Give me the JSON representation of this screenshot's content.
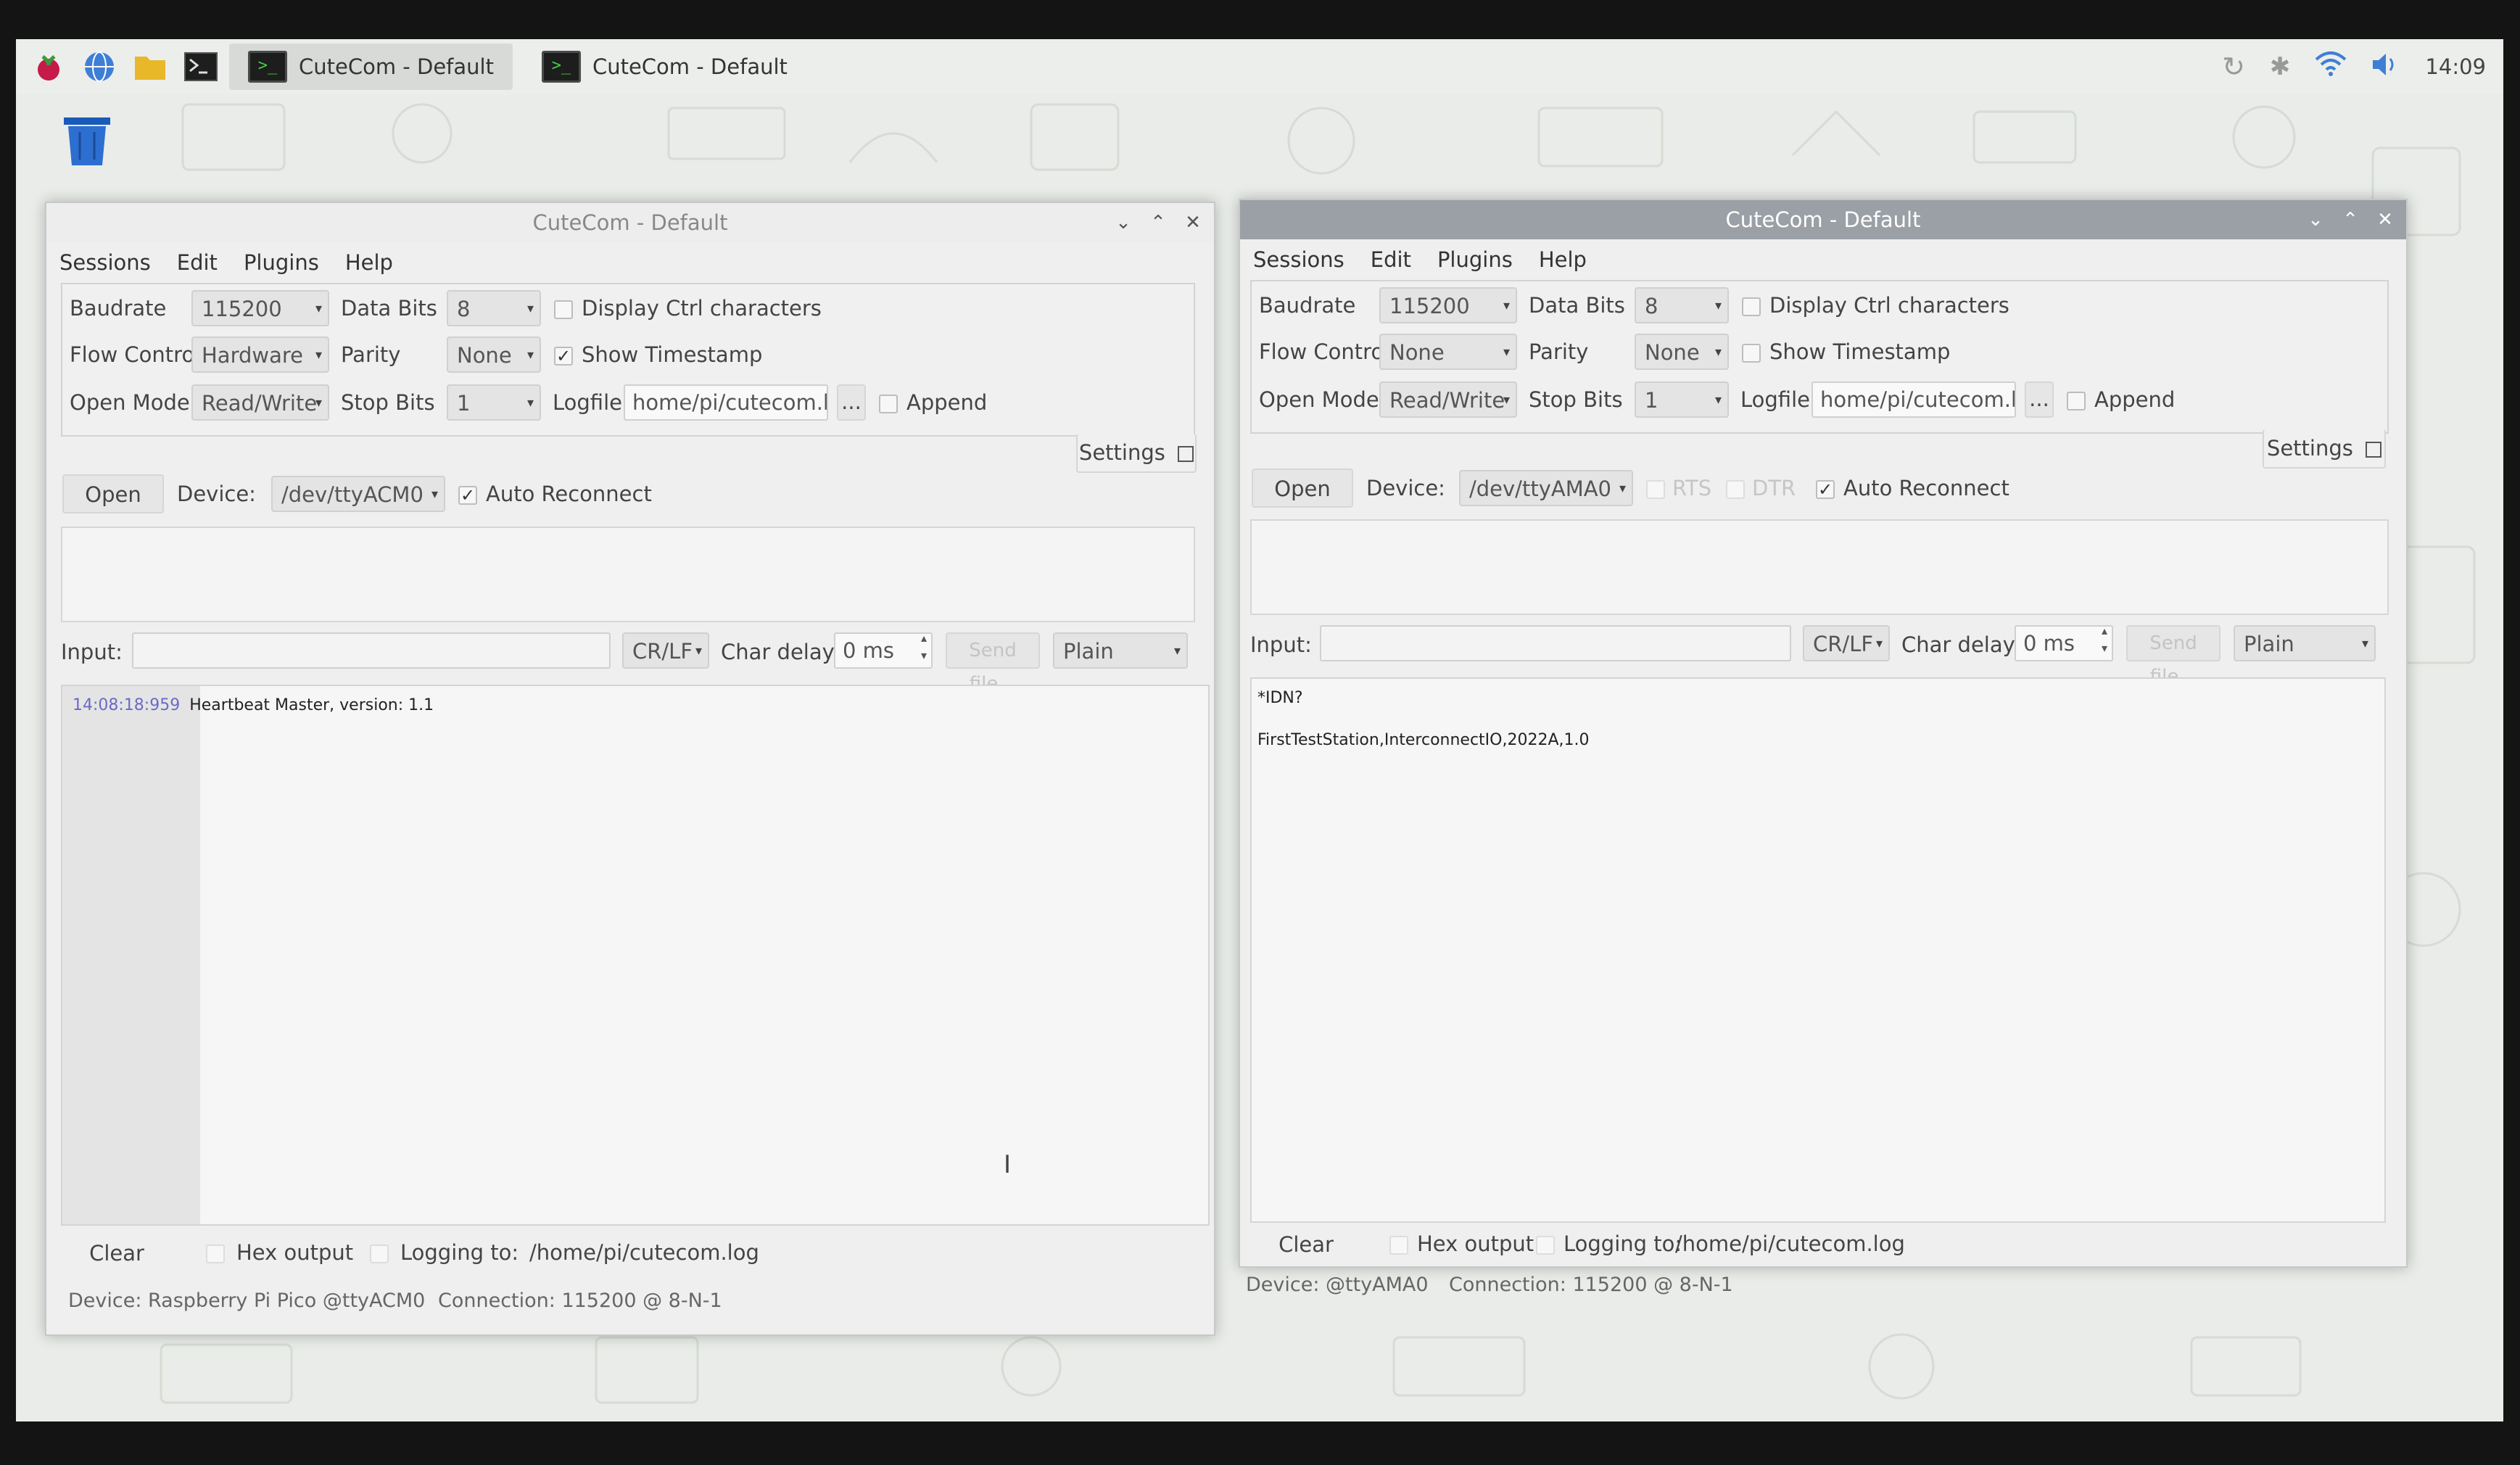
{
  "taskbar": {
    "tasks": [
      {
        "label": "CuteCom - Default"
      },
      {
        "label": "CuteCom - Default"
      }
    ],
    "clock": "14:09"
  },
  "left": {
    "title": "CuteCom - Default",
    "menu": [
      "Sessions",
      "Edit",
      "Plugins",
      "Help"
    ],
    "baudrate_label": "Baudrate",
    "baudrate": "115200",
    "databits_label": "Data Bits",
    "databits": "8",
    "display_ctrl": "Display Ctrl characters",
    "flow_label": "Flow Control",
    "flow": "Hardware",
    "parity_label": "Parity",
    "parity": "None",
    "show_ts": "Show Timestamp",
    "openmode_label": "Open Mode",
    "openmode": "Read/Write",
    "stopbits_label": "Stop Bits",
    "stopbits": "1",
    "logfile_label": "Logfile:",
    "logfile": "home/pi/cutecom.log",
    "browse": "...",
    "append": "Append",
    "settings": "Settings",
    "open": "Open",
    "device_label": "Device:",
    "device": "/dev/ttyACM0",
    "auto_reconnect": "Auto Reconnect",
    "input_label": "Input:",
    "line_end": "CR/LF",
    "char_delay_label": "Char delay:",
    "char_delay": "0 ms",
    "send_file": "Send file...",
    "format": "Plain",
    "output": [
      {
        "ts": "14:08:18:959",
        "text": "Heartbeat Master, version: 1.1"
      }
    ],
    "clear": "Clear",
    "hex": "Hex output",
    "logging_label": "Logging to:",
    "logging_path": "/home/pi/cutecom.log",
    "status_device": "Device:  Raspberry Pi Pico @ttyACM0",
    "status_conn": "Connection:  115200 @ 8-N-1"
  },
  "right": {
    "title": "CuteCom - Default",
    "menu": [
      "Sessions",
      "Edit",
      "Plugins",
      "Help"
    ],
    "baudrate_label": "Baudrate",
    "baudrate": "115200",
    "databits_label": "Data Bits",
    "databits": "8",
    "display_ctrl": "Display Ctrl characters",
    "flow_label": "Flow Control",
    "flow": "None",
    "parity_label": "Parity",
    "parity": "None",
    "show_ts": "Show Timestamp",
    "openmode_label": "Open Mode",
    "openmode": "Read/Write",
    "stopbits_label": "Stop Bits",
    "stopbits": "1",
    "logfile_label": "Logfile:",
    "logfile": "home/pi/cutecom.log",
    "browse": "...",
    "append": "Append",
    "settings": "Settings",
    "open": "Open",
    "device_label": "Device:",
    "device": "/dev/ttyAMA0",
    "rts": "RTS",
    "dtr": "DTR",
    "auto_reconnect": "Auto Reconnect",
    "input_label": "Input:",
    "line_end": "CR/LF",
    "char_delay_label": "Char delay:",
    "char_delay": "0 ms",
    "send_file": "Send file...",
    "format": "Plain",
    "output": [
      "*IDN?",
      "FirstTestStation,InterconnectIO,2022A,1.0"
    ],
    "clear": "Clear",
    "hex": "Hex output",
    "logging_label": "Logging to:",
    "logging_path": "/home/pi/cutecom.log",
    "status_device": "Device:   @ttyAMA0",
    "status_conn": "Connection:  115200 @ 8-N-1"
  }
}
